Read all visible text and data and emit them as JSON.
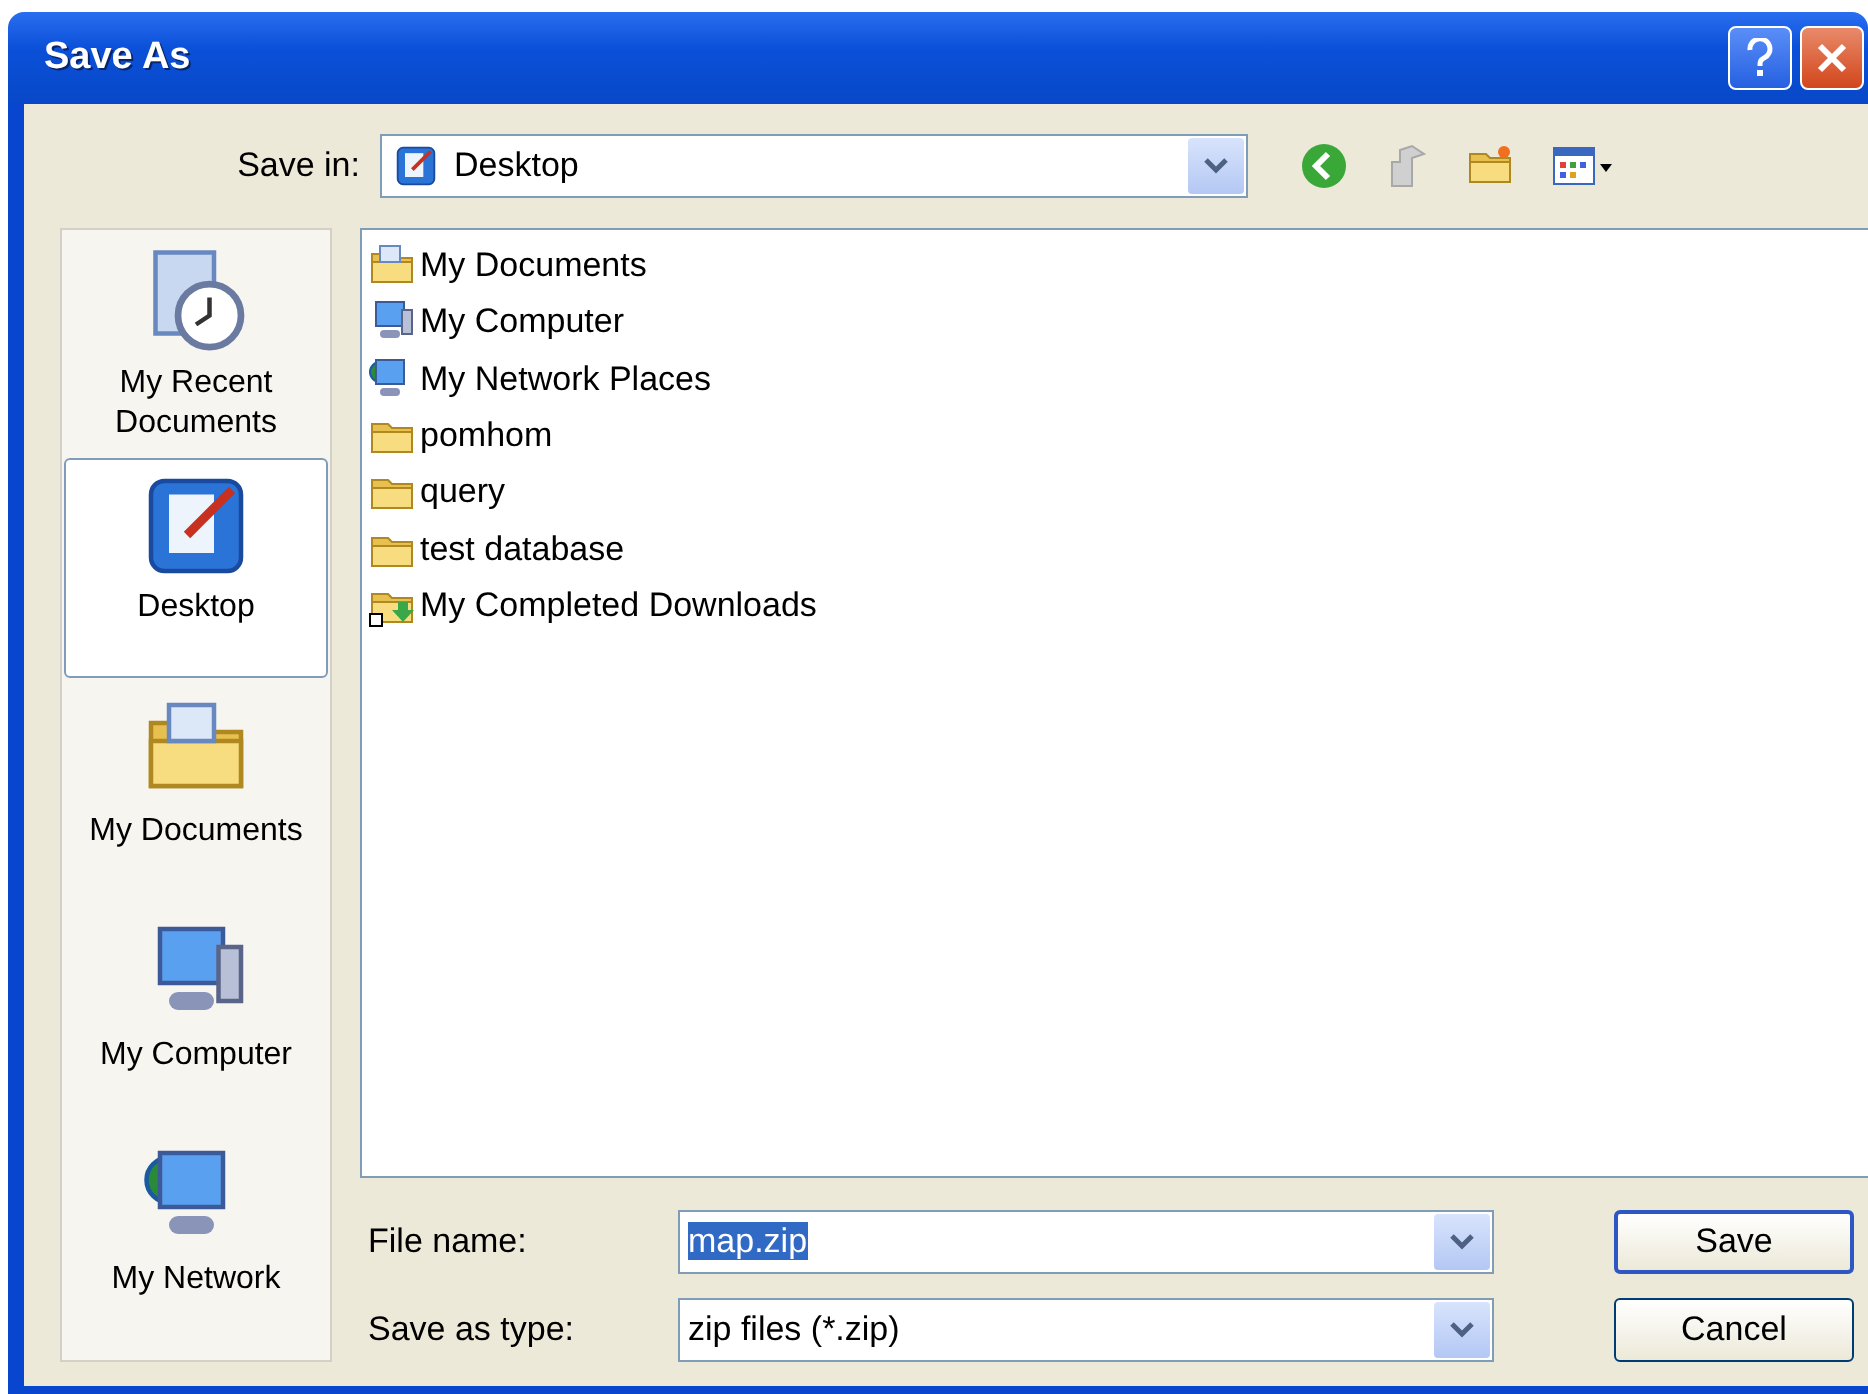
{
  "window": {
    "title": "Save As"
  },
  "save_in": {
    "label": "Save in:",
    "value": "Desktop"
  },
  "places": [
    {
      "label": "My Recent Documents",
      "kind": "recent",
      "selected": false
    },
    {
      "label": "Desktop",
      "kind": "desktop",
      "selected": true
    },
    {
      "label": "My Documents",
      "kind": "documents",
      "selected": false
    },
    {
      "label": "My Computer",
      "kind": "computer",
      "selected": false
    },
    {
      "label": "My Network",
      "kind": "network",
      "selected": false
    }
  ],
  "files": [
    {
      "name": "My Documents",
      "kind": "documents"
    },
    {
      "name": "My Computer",
      "kind": "computer"
    },
    {
      "name": "My Network Places",
      "kind": "network"
    },
    {
      "name": "pomhom",
      "kind": "folder"
    },
    {
      "name": "query",
      "kind": "folder"
    },
    {
      "name": "test database",
      "kind": "folder"
    },
    {
      "name": "My Completed Downloads",
      "kind": "downloads"
    }
  ],
  "file_name": {
    "label": "File name:",
    "value": "map.zip",
    "value_selected": true
  },
  "save_as_type": {
    "label": "Save as type:",
    "value": "zip files (*.zip)"
  },
  "buttons": [
    {
      "label": "Save",
      "default": true
    },
    {
      "label": "Cancel",
      "default": false
    }
  ]
}
